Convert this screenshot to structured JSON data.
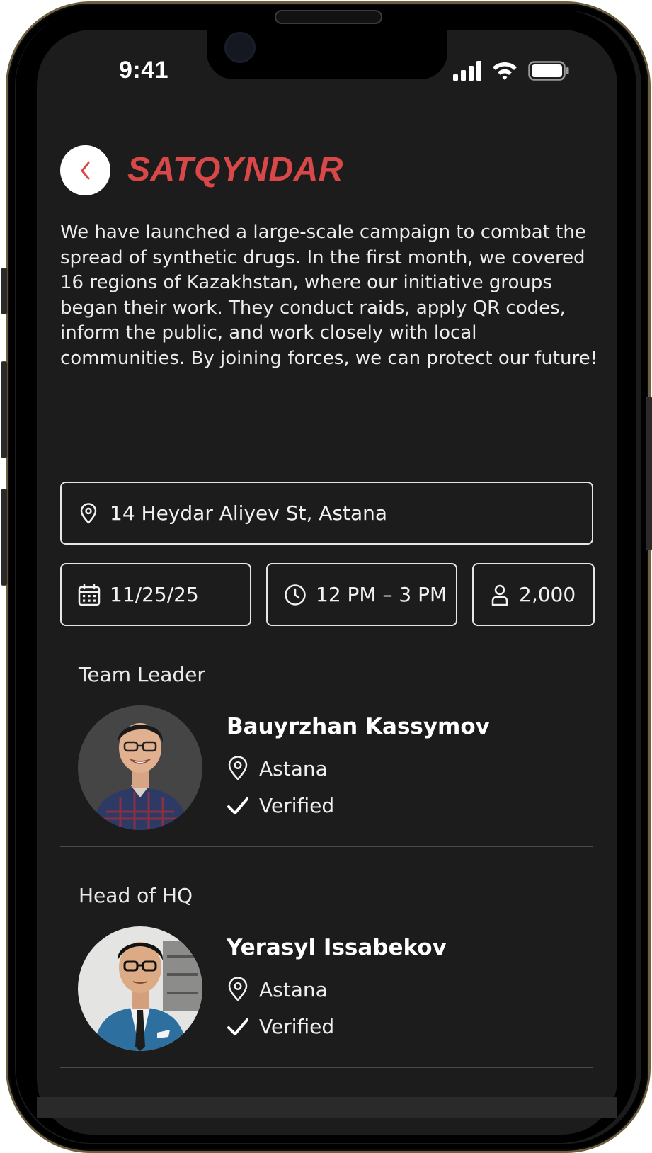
{
  "status_bar": {
    "time": "9:41"
  },
  "header": {
    "title": "SATQYNDAR",
    "back_icon": "chevron-left-icon"
  },
  "description": "We have launched a large-scale campaign to combat the spread of synthetic drugs. In the first month, we covered 16 regions of Kazakhstan, where our initiative groups began their work. They conduct raids, apply QR codes, inform the public, and work closely with local communities. By joining forces, we can protect our future!",
  "event": {
    "address": "14 Heydar Aliyev St, Astana",
    "date": "11/25/25",
    "time": "12 PM – 3 PM",
    "participants": "2,000"
  },
  "people": [
    {
      "role": "Team Leader",
      "name": "Bauyrzhan Kassymov",
      "city": "Astana",
      "status": "Verified"
    },
    {
      "role": "Head of HQ",
      "name": "Yerasyl Issabekov",
      "city": "Astana",
      "status": "Verified"
    }
  ],
  "colors": {
    "accent": "#d94848",
    "background": "#1c1c1c",
    "text": "#ffffff"
  }
}
